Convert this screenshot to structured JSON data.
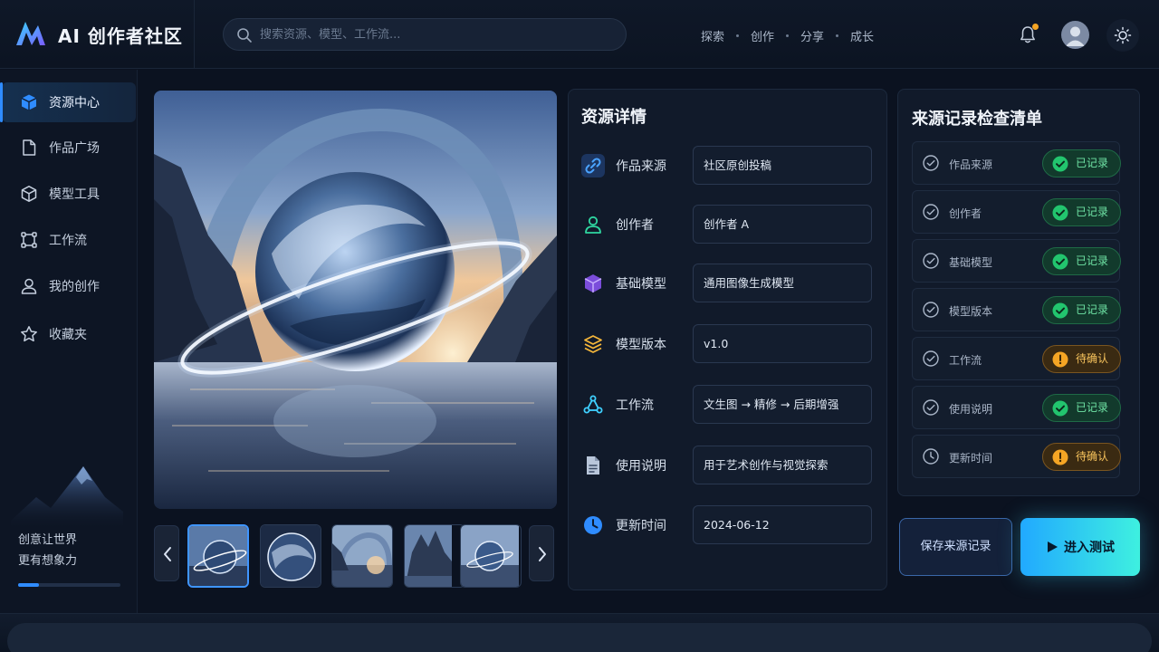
{
  "app": {
    "brand": "AI 创作者社区"
  },
  "search": {
    "placeholder": "搜索资源、模型、工作流..."
  },
  "topnav": {
    "items": [
      "探索",
      "创作",
      "分享",
      "成长"
    ]
  },
  "sidebar": {
    "items": [
      {
        "label": "资源中心",
        "icon": "cube-icon",
        "active": true
      },
      {
        "label": "作品广场",
        "icon": "file-icon"
      },
      {
        "label": "模型工具",
        "icon": "box-icon"
      },
      {
        "label": "工作流",
        "icon": "workflow-icon"
      },
      {
        "label": "我的创作",
        "icon": "user-icon"
      },
      {
        "label": "收藏夹",
        "icon": "star-icon"
      }
    ],
    "slogan_line1": "创意让世界",
    "slogan_line2": "更有想象力",
    "progress": 0.2
  },
  "details": {
    "title": "资源详情",
    "rows": [
      {
        "label": "作品来源",
        "value": "社区原创投稿",
        "icon": "link-icon"
      },
      {
        "label": "创作者",
        "value": "创作者 A",
        "icon": "user-icon"
      },
      {
        "label": "基础模型",
        "value": "通用图像生成模型",
        "icon": "cube-icon"
      },
      {
        "label": "模型版本",
        "value": "v1.0",
        "icon": "layers-icon"
      },
      {
        "label": "工作流",
        "value": "文生图 → 精修 → 后期增强",
        "icon": "workflow-icon"
      },
      {
        "label": "使用说明",
        "value": "用于艺术创作与视觉探索",
        "icon": "document-icon"
      },
      {
        "label": "更新时间",
        "value": "2024-06-12",
        "icon": "clock-icon"
      }
    ]
  },
  "checklist": {
    "title": "来源记录检查清单",
    "items": [
      {
        "label": "作品来源",
        "status": "已记录",
        "state": "ok"
      },
      {
        "label": "创作者",
        "status": "已记录",
        "state": "ok"
      },
      {
        "label": "基础模型",
        "status": "已记录",
        "state": "ok"
      },
      {
        "label": "模型版本",
        "status": "已记录",
        "state": "ok"
      },
      {
        "label": "工作流",
        "status": "待确认",
        "state": "warn"
      },
      {
        "label": "使用说明",
        "status": "已记录",
        "state": "ok"
      },
      {
        "label": "更新时间",
        "status": "待确认",
        "state": "warn"
      }
    ]
  },
  "actions": {
    "save_label": "保存来源记录",
    "enter_label": "进入测试"
  },
  "colors": {
    "accent": "#2f8cff",
    "ok": "#22c56e",
    "warn": "#f5a524",
    "cta_start": "#21a9ff",
    "cta_end": "#3ef0e0"
  }
}
